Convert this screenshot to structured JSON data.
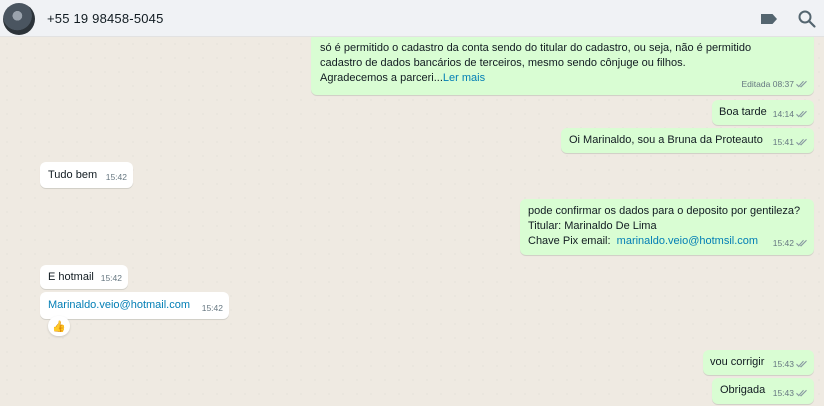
{
  "header": {
    "contact_name": "+55 19 98458-5045",
    "icons": [
      "label-icon",
      "search-icon"
    ]
  },
  "messages": [
    {
      "id": "m1",
      "direction": "outgoing",
      "lines": [
        "só é permitido o cadastro da conta sendo do titular do cadastro, ou seja, não é permitido",
        "cadastro de dados bancários de terceiros, mesmo sendo cônjuge ou filhos.",
        "Agradecemos a parceri..."
      ],
      "read_more": "Ler mais",
      "edited_label": "Editada",
      "time": "08:37"
    },
    {
      "id": "m2",
      "direction": "outgoing",
      "text": "Boa tarde",
      "time": "14:14"
    },
    {
      "id": "m3",
      "direction": "outgoing",
      "text": "Oi Marinaldo, sou a Bruna da Proteauto",
      "time": "15:41"
    },
    {
      "id": "m4",
      "direction": "incoming",
      "text": "Tudo bem",
      "time": "15:42"
    },
    {
      "id": "m5",
      "direction": "outgoing",
      "lines": [
        "pode confirmar os dados para o deposito por gentileza?",
        "Titular: Marinaldo De Lima"
      ],
      "email_label": "Chave Pix email:",
      "email": "marinaldo.veio@hotmsil.com",
      "time": "15:42"
    },
    {
      "id": "m6",
      "direction": "incoming",
      "text": "E hotmail",
      "time": "15:42"
    },
    {
      "id": "m7",
      "direction": "incoming",
      "link": "Marinaldo.veio@hotmail.com",
      "time": "15:42",
      "reaction": "👍"
    },
    {
      "id": "m8",
      "direction": "outgoing",
      "text": "vou corrigir",
      "time": "15:43"
    },
    {
      "id": "m9",
      "direction": "outgoing",
      "text": "Obrigada",
      "time": "15:43"
    }
  ],
  "colors": {
    "outgoing_bubble": "#d9fdd3",
    "incoming_bubble": "#ffffff",
    "link": "#027eb5",
    "tick": "#8696a0"
  }
}
